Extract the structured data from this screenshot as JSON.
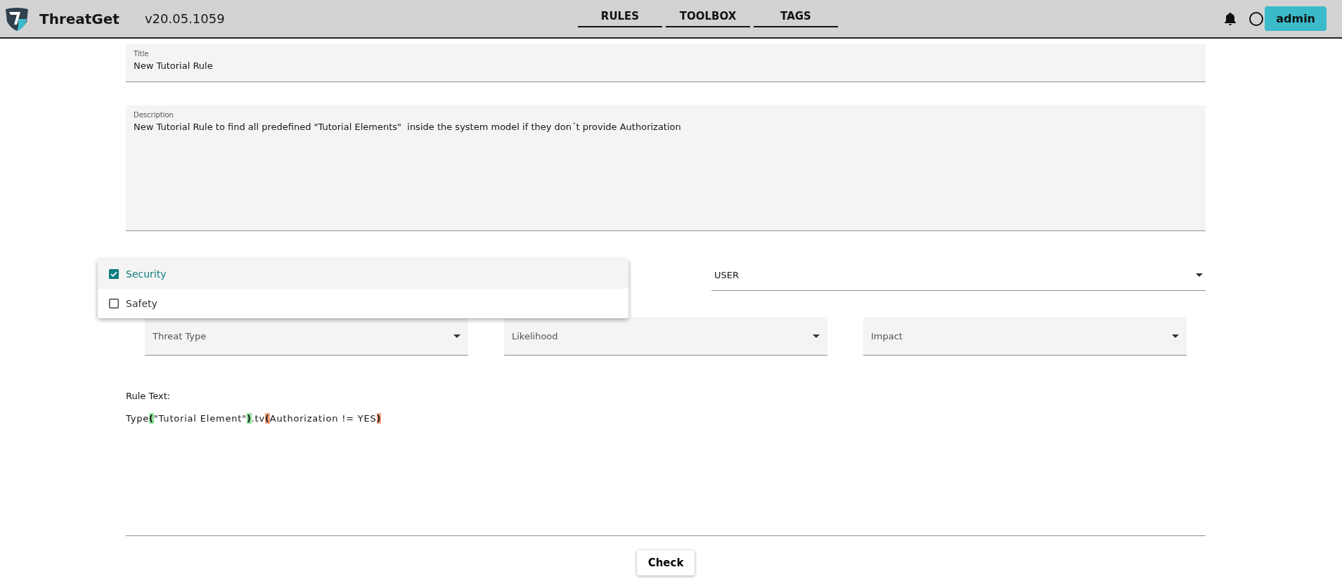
{
  "header": {
    "app_name": "ThreatGet",
    "version": "v20.05.1059",
    "nav": [
      {
        "label": "RULES"
      },
      {
        "label": "TOOLBOX"
      },
      {
        "label": "TAGS"
      }
    ],
    "user_button": "admin"
  },
  "title_field": {
    "label": "Title",
    "value": "New Tutorial Rule"
  },
  "description_field": {
    "label": "Description",
    "value": "New Tutorial Rule to find all predefined \"Tutorial Elements\"  inside the system model if they don´t provide Authorization"
  },
  "tags_dropdown": {
    "options": [
      {
        "label": "Security",
        "checked": true
      },
      {
        "label": "Safety",
        "checked": false
      }
    ]
  },
  "role_select": {
    "value": "USER"
  },
  "selects": [
    {
      "placeholder": "Threat Type"
    },
    {
      "placeholder": "Likelihood"
    },
    {
      "placeholder": "Impact"
    }
  ],
  "rule_text": {
    "label": "Rule Text:",
    "tokens": [
      {
        "text": "Type"
      },
      {
        "text": "(",
        "color": "#8fe39a"
      },
      {
        "text": "\"Tutorial Element\""
      },
      {
        "text": ")",
        "color": "#8fe39a"
      },
      {
        "text": ".tv"
      },
      {
        "text": "(",
        "color": "#f5a27e"
      },
      {
        "text": "Authorization != YES"
      },
      {
        "text": ")",
        "color": "#f5a27e"
      }
    ]
  },
  "check_button": "Check"
}
